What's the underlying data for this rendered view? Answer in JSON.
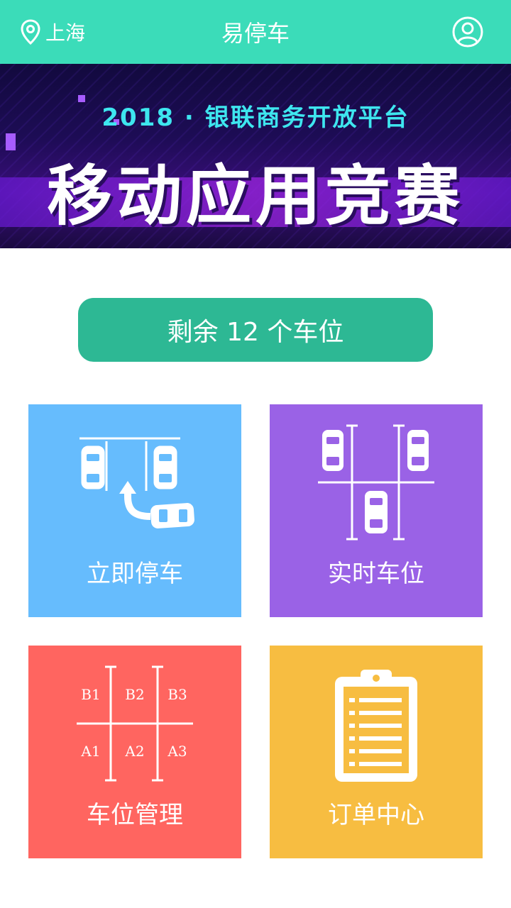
{
  "header": {
    "city": "上海",
    "title": "易停车",
    "icons": {
      "location": "location-pin-icon",
      "user": "user-profile-icon"
    },
    "background": "#3bdcb9"
  },
  "banner": {
    "subtitle": "2018 · 银联商务开放平台",
    "headline": "移动应用竞赛"
  },
  "availability": {
    "label": "剩余 12 个车位",
    "color": "#2db894"
  },
  "tiles": [
    {
      "label": "立即停车",
      "icon": "park-now-icon",
      "color": "#66bcfd"
    },
    {
      "label": "实时车位",
      "icon": "realtime-spaces-icon",
      "color": "#9a62e6"
    },
    {
      "label": "车位管理",
      "icon": "space-management-icon",
      "color": "#ff6560",
      "grid_labels": [
        "B1",
        "B2",
        "B3",
        "A1",
        "A2",
        "A3"
      ]
    },
    {
      "label": "订单中心",
      "icon": "clipboard-icon",
      "color": "#f7bd41"
    }
  ]
}
